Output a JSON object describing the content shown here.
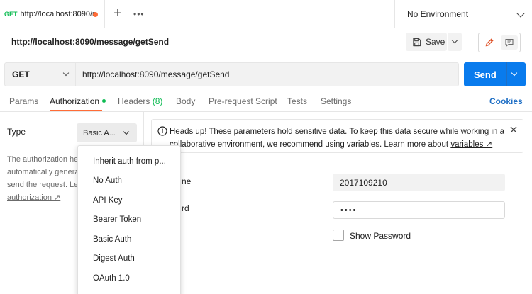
{
  "tabbar": {
    "tab": {
      "method": "GET",
      "name": "http://localhost:8090/r"
    },
    "new_tab_glyph": "+",
    "more_glyph": "•••",
    "environment": "No Environment"
  },
  "request": {
    "title": "http://localhost:8090/message/getSend",
    "save_label": "Save",
    "method": "GET",
    "url": "http://localhost:8090/message/getSend",
    "send_label": "Send"
  },
  "tabs": {
    "params": "Params",
    "authorization": "Authorization",
    "headers": "Headers",
    "headers_count": "(8)",
    "body": "Body",
    "pre_request": "Pre-request Script",
    "tests": "Tests",
    "settings": "Settings",
    "cookies": "Cookies"
  },
  "auth": {
    "type_label": "Type",
    "type_value": "Basic A...",
    "description_lines": [
      "The authorization he",
      "automatically genera",
      "send the request. Le"
    ],
    "description_link": "authorization ↗"
  },
  "banner": {
    "text": "Heads up! These parameters hold sensitive data. To keep this data secure while working in a collaborative environment, we recommend using variables. Learn more about ",
    "link": "variables ↗"
  },
  "fields": {
    "username_label_fragment": "ne",
    "username_value": "2017109210",
    "password_label_fragment": "rd",
    "password_value": "••••",
    "show_password": "Show Password"
  },
  "menu": {
    "items": [
      "Inherit auth from p...",
      "No Auth",
      "API Key",
      "Bearer Token",
      "Basic Auth",
      "Digest Auth",
      "OAuth 1.0"
    ]
  },
  "colors": {
    "accent": "#ff6c37",
    "send": "#097bed",
    "method_get": "#0cbb52",
    "link": "#1f6fc5"
  }
}
